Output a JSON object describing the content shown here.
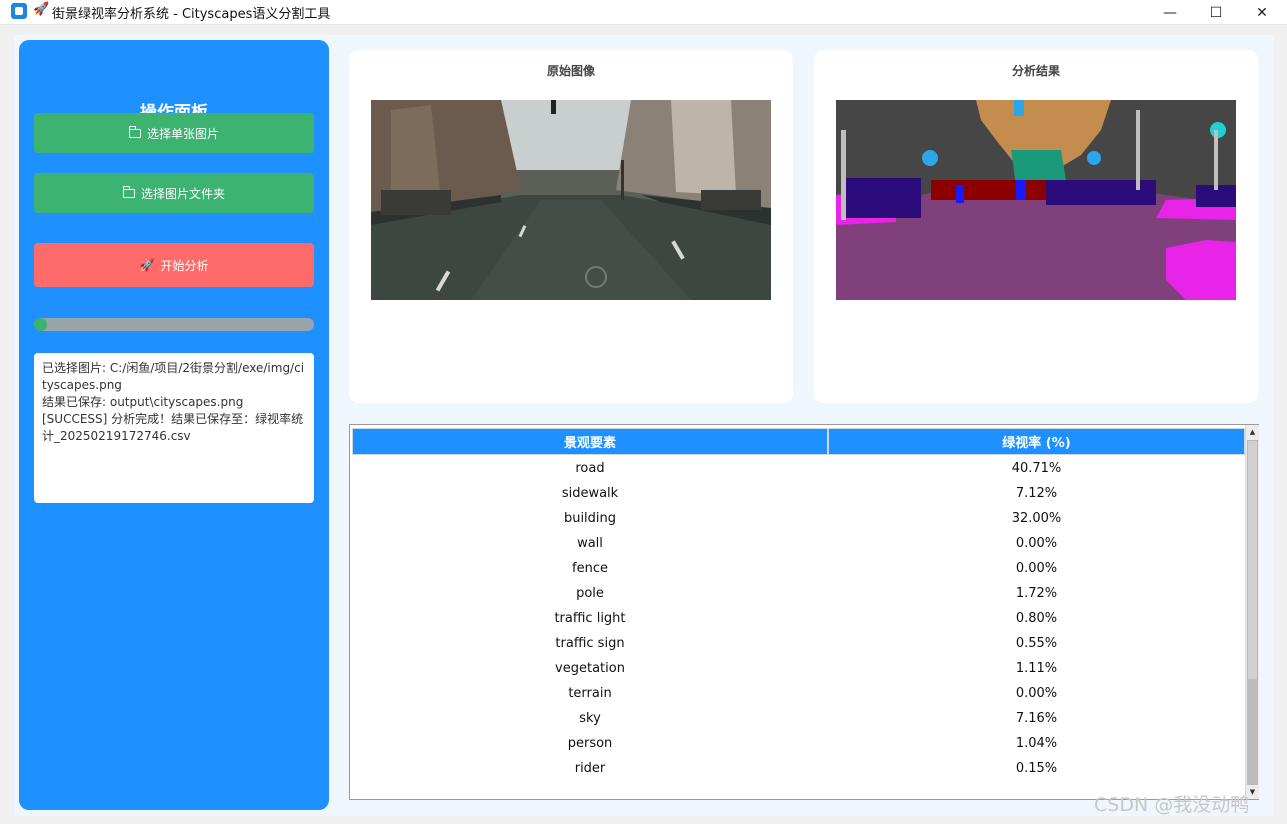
{
  "window": {
    "title": "街景绿视率分析系统 - Cityscapes语义分割工具",
    "rocket_glyph": "🚀",
    "controls": {
      "minimize": "—",
      "maximize": "☐",
      "close": "✕"
    }
  },
  "panel": {
    "title": "操作面板",
    "select_image_label": "选择单张图片",
    "select_folder_label": "选择图片文件夹",
    "start_label": "开始分析",
    "progress": 0.03,
    "log": [
      "已选择图片: C:/闲鱼/项目/2街景分割/exe/img/cityscapes.png",
      "结果已保存: output\\cityscapes.png",
      "[SUCCESS] 分析完成！结果已保存至：绿视率统计_20250219172746.csv"
    ]
  },
  "images": {
    "original_title": "原始图像",
    "result_title": "分析结果"
  },
  "table": {
    "headers": [
      "景观要素",
      "绿视率 (%)"
    ],
    "rows": [
      [
        "road",
        "40.71%"
      ],
      [
        "sidewalk",
        "7.12%"
      ],
      [
        "building",
        "32.00%"
      ],
      [
        "wall",
        "0.00%"
      ],
      [
        "fence",
        "0.00%"
      ],
      [
        "pole",
        "1.72%"
      ],
      [
        "traffic light",
        "0.80%"
      ],
      [
        "traffic sign",
        "0.55%"
      ],
      [
        "vegetation",
        "1.11%"
      ],
      [
        "terrain",
        "0.00%"
      ],
      [
        "sky",
        "7.16%"
      ],
      [
        "person",
        "1.04%"
      ],
      [
        "rider",
        "0.15%"
      ]
    ]
  },
  "colors": {
    "panel": "#1e90ff",
    "green_button": "#3cb371",
    "red_button": "#ff6b6b",
    "header": "#1e90ff"
  },
  "watermark": "CSDN @我没动鸭"
}
